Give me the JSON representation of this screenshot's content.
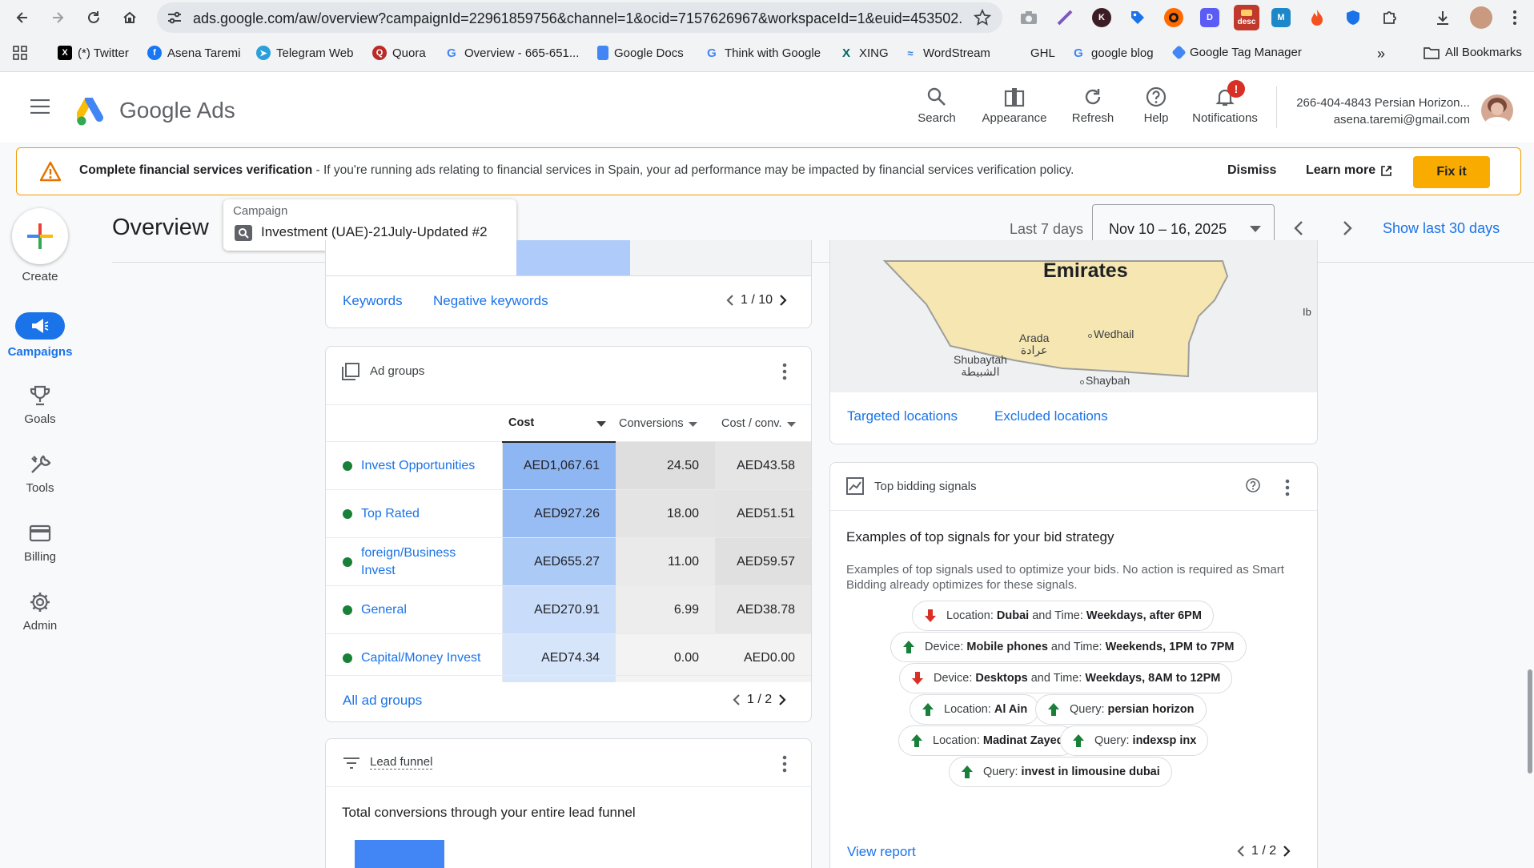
{
  "browser": {
    "url": "ads.google.com/aw/overview?campaignId=22961859756&channel=1&ocid=7157626967&workspaceId=1&euid=453502...",
    "desc_badge": "desc",
    "bookmarks": [
      {
        "label": "(*) Twitter",
        "icon": "x-twitter-icon"
      },
      {
        "label": "Asena Taremi",
        "icon": "facebook-icon"
      },
      {
        "label": "Telegram Web",
        "icon": "telegram-icon"
      },
      {
        "label": "Quora",
        "icon": "quora-icon"
      },
      {
        "label": "Overview - 665-651...",
        "icon": "google-icon"
      },
      {
        "label": "Google Docs",
        "icon": "google-docs-icon"
      },
      {
        "label": "Think with Google",
        "icon": "google-icon"
      },
      {
        "label": "XING",
        "icon": "xing-icon"
      },
      {
        "label": "WordStream",
        "icon": "wordstream-icon"
      },
      {
        "label": "GHL",
        "icon": "blank-icon"
      },
      {
        "label": "google blog",
        "icon": "google-icon"
      },
      {
        "label": "Google Tag Manager",
        "icon": "tag-manager-icon"
      }
    ],
    "all_bookmarks": "All Bookmarks"
  },
  "header": {
    "brand_google": "Google",
    "brand_ads": "Ads",
    "search": "Search",
    "appearance": "Appearance",
    "refresh": "Refresh",
    "help": "Help",
    "notifications": "Notifications",
    "notification_badge": "!",
    "account_name": "266-404-4843 Persian Horizon...",
    "account_email": "asena.taremi@gmail.com"
  },
  "banner": {
    "title": "Complete financial services verification",
    "text": " - If you're running ads relating to financial services in Spain, your ad performance may be impacted by financial services verification policy.",
    "dismiss": "Dismiss",
    "learn_more": "Learn more",
    "fix": "Fix it"
  },
  "sidebar": {
    "create": "Create",
    "campaigns": "Campaigns",
    "goals": "Goals",
    "tools": "Tools",
    "billing": "Billing",
    "admin": "Admin"
  },
  "page": {
    "title": "Overview",
    "campaign_label": "Campaign",
    "campaign_name": "Investment (UAE)-21July-Updated #2",
    "date_range_label": "Last 7 days",
    "date_range": "Nov 10 – 16, 2025",
    "show_last_30": "Show last 30 days"
  },
  "keywords_card": {
    "keywords": "Keywords",
    "negative_keywords": "Negative keywords",
    "pagination": "1 / 10"
  },
  "ad_groups": {
    "title": "Ad groups",
    "columns": {
      "cost": "Cost",
      "conversions": "Conversions",
      "cost_conv": "Cost / conv."
    },
    "rows": [
      {
        "name": "Invest Opportunities",
        "cost": "AED1,067.61",
        "conv": "24.50",
        "cpc": "AED43.58",
        "cost_shade": 1.0,
        "conv_shade": 1.0,
        "cpc_shade": 0.75
      },
      {
        "name": "Top Rated",
        "cost": "AED927.26",
        "conv": "18.00",
        "cpc": "AED51.51",
        "cost_shade": 0.87,
        "conv_shade": 0.73,
        "cpc_shade": 0.86
      },
      {
        "name": "foreign/Business Invest",
        "cost": "AED655.27",
        "conv": "11.00",
        "cpc": "AED59.57",
        "cost_shade": 0.61,
        "conv_shade": 0.45,
        "cpc_shade": 1.0
      },
      {
        "name": "General",
        "cost": "AED270.91",
        "conv": "6.99",
        "cpc": "AED38.78",
        "cost_shade": 0.25,
        "conv_shade": 0.29,
        "cpc_shade": 0.65
      },
      {
        "name": "Capital/Money Invest",
        "cost": "AED74.34",
        "conv": "0.00",
        "cpc": "AED0.00",
        "cost_shade": 0.07,
        "conv_shade": 0.0,
        "cpc_shade": 0.0
      }
    ],
    "all_link": "All ad groups",
    "pagination": "1 / 2"
  },
  "lead_funnel": {
    "title": "Lead funnel",
    "subtitle": "Total conversions through your entire lead funnel"
  },
  "map_card": {
    "country": "Emirates",
    "places": [
      {
        "name": "Arada",
        "native": "عرادة"
      },
      {
        "name": "Wedhail"
      },
      {
        "name": "Shubaytah",
        "native": "الشبيطة"
      },
      {
        "name": "Shaybah"
      }
    ],
    "edge_label": "Ib",
    "targeted": "Targeted locations",
    "excluded": "Excluded locations"
  },
  "bidding": {
    "title": "Top bidding signals",
    "heading": "Examples of top signals for your bid strategy",
    "description": "Examples of top signals used to optimize your bids. No action is required as Smart Bidding already optimizes for these signals.",
    "chips": [
      {
        "dir": "down",
        "parts": [
          [
            "Location: ",
            false
          ],
          [
            "Dubai",
            true
          ],
          [
            " and Time: ",
            false
          ],
          [
            "Weekdays, after 6PM",
            true
          ]
        ]
      },
      {
        "dir": "up",
        "parts": [
          [
            "Device: ",
            false
          ],
          [
            "Mobile phones",
            true
          ],
          [
            " and Time: ",
            false
          ],
          [
            "Weekends, 1PM to 7PM",
            true
          ]
        ]
      },
      {
        "dir": "down",
        "parts": [
          [
            "Device: ",
            false
          ],
          [
            "Desktops",
            true
          ],
          [
            " and Time: ",
            false
          ],
          [
            "Weekdays, 8AM to 12PM",
            true
          ]
        ]
      },
      {
        "dir": "up",
        "parts": [
          [
            "Location: ",
            false
          ],
          [
            "Al Ain",
            true
          ]
        ]
      },
      {
        "dir": "up",
        "parts": [
          [
            "Query: ",
            false
          ],
          [
            "persian horizon",
            true
          ]
        ]
      },
      {
        "dir": "up",
        "parts": [
          [
            "Location: ",
            false
          ],
          [
            "Madinat Zayed",
            true
          ]
        ]
      },
      {
        "dir": "up",
        "parts": [
          [
            "Query: ",
            false
          ],
          [
            "indexsp inx",
            true
          ]
        ]
      },
      {
        "dir": "up",
        "parts": [
          [
            "Query: ",
            false
          ],
          [
            "invest in limousine dubai",
            true
          ]
        ]
      }
    ],
    "view_report": "View report",
    "pagination": "1 / 2"
  },
  "colors": {
    "accent_blue": "#1a73e8",
    "status_green": "#188038",
    "warning_orange": "#f29900",
    "fix_yellow": "#f9ab00",
    "signal_up": "#188038",
    "signal_down": "#d93025"
  }
}
